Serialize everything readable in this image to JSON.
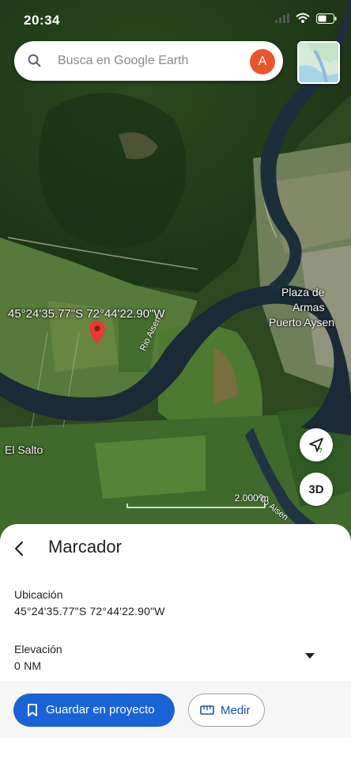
{
  "status_bar": {
    "time": "20:34"
  },
  "search": {
    "placeholder": "Busca en Google Earth",
    "avatar_letter": "A"
  },
  "map": {
    "coordinates": "45°24'35.77\"S 72°44'22.90\"W",
    "places": {
      "plaza_line1": "Plaza de",
      "plaza_line2": "Armas",
      "puerto": "Puerto Aysen",
      "el_salto": "El Salto"
    },
    "river_label": "Rio Aisen",
    "river_label_2": "Rio Aisen",
    "scale_text": "2.000 m",
    "btn_3d": "3D",
    "icons": [
      "search-icon",
      "location-arrow-icon",
      "map-pin-icon",
      "layers-icon"
    ]
  },
  "sheet": {
    "title": "Marcador",
    "location_label": "Ubicación",
    "location_value": "45°24'35.77\"S 72°44'22.90\"W",
    "elevation_label": "Elevación",
    "elevation_value": "0 NM",
    "save_button": "Guardar en proyecto",
    "measure_button": "Medir"
  },
  "colors": {
    "primary": "#1a63d6",
    "avatar": "#e8552a",
    "pin": "#e53935"
  }
}
